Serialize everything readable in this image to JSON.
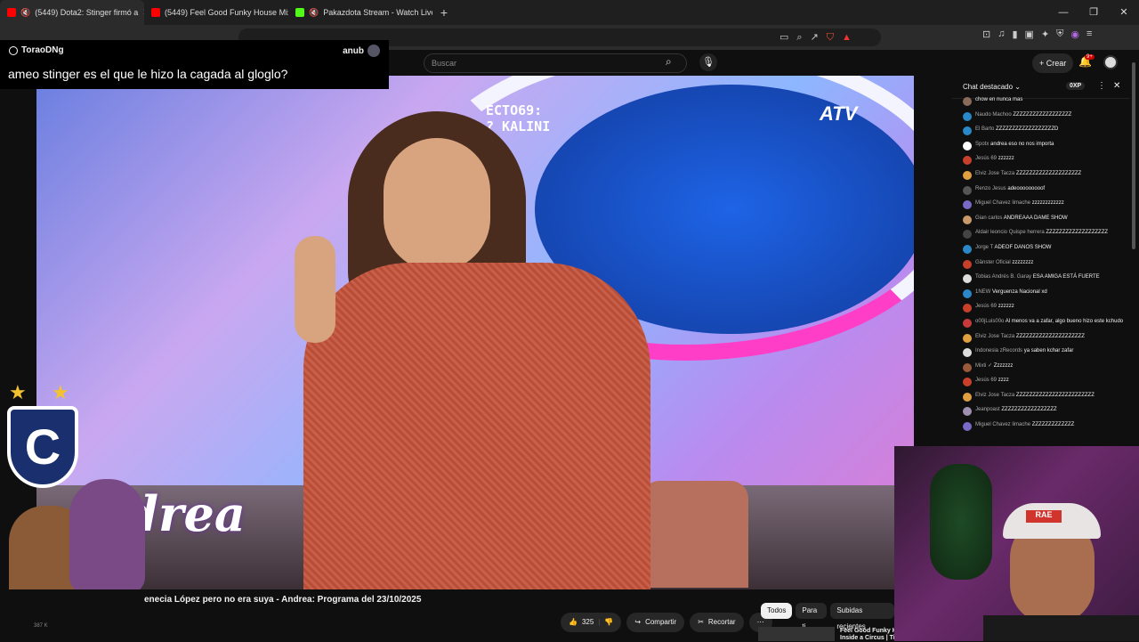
{
  "browser": {
    "tabs": [
      {
        "label": "(5449) Dota2: Stinger firmó a",
        "color": "#ff0000",
        "active": true
      },
      {
        "label": "(5449) Feel Good Funky House Mix",
        "color": "#ff0000",
        "active": false
      },
      {
        "label": "Pakazdota Stream - Watch Live o",
        "color": "#53fc18",
        "active": false
      }
    ],
    "new_tab": "+",
    "url": "",
    "window": {
      "minimize": "—",
      "restore": "❐",
      "close": "✕"
    }
  },
  "youtube": {
    "search_placeholder": "Buscar",
    "create_label": "Crear",
    "notif_count": "9+",
    "video_title": "enecia López pero no era suya - Andrea: Programa del 23/10/2025",
    "video_overlay": "ECTO69:\n? KALINI",
    "video_logo": "ndrea",
    "video_channel": "ATV",
    "likes": "325",
    "share_label": "Compartir",
    "clip_label": "Recortar",
    "chips": [
      "Todos",
      "Para ti",
      "Subidas recientes"
    ],
    "rec_title": "Feel Good Funky Ho\nInside a Circus | Tin",
    "views_snippet": "387 K"
  },
  "overlay_chat": {
    "username": "ToraoDNg",
    "right_name": "anub",
    "message": "ameo stinger es el que le hizo la cagada al gloglo?"
  },
  "chat": {
    "title": "Chat destacado",
    "points": "0XP",
    "messages": [
      {
        "name": "",
        "text": "chow en nunca mas",
        "color": "#8a6b5a"
      },
      {
        "name": "Naudo Machoo",
        "text": "ZZZZZZZZZZZZZZZZZZ",
        "color": "#2a88c8"
      },
      {
        "name": "El Barto",
        "text": "ZZZZZZZZZZZZZZZZZZD",
        "color": "#2a88c8"
      },
      {
        "name": "Spotx",
        "text": "andrea eso no nos importa",
        "color": "#ffffff"
      },
      {
        "name": "Jesús 69",
        "text": "zzzzzz",
        "color": "#c8402a"
      },
      {
        "name": "Elviz Jose Tacza",
        "text": "ZZZZZZZZZZZZZZZZZZZZ",
        "color": "#e0a040"
      },
      {
        "name": "Renzo Jesus",
        "text": "adeooooooooof",
        "color": "#555555"
      },
      {
        "name": "Miguel Chavez limache",
        "text": "zzzzzzzzzzzz",
        "color": "#7a6ac8"
      },
      {
        "name": "Gian carlos",
        "text": "ANDREAAA DAME SHOW",
        "color": "#c89a6a"
      },
      {
        "name": "Aldair leoncio Quispe herrera",
        "text": "ZZZZZZZZZZZZZZZZZZZ",
        "color": "#444444"
      },
      {
        "name": "Jorge T",
        "text": "ADEOF DANOS SHOW",
        "color": "#2a88c8"
      },
      {
        "name": "Gänster Oficial",
        "text": "zzzzzzzz",
        "color": "#c8402a"
      },
      {
        "name": "Tobias Andrés B. Garay",
        "text": "ESA AMIGA ESTÁ FUERTE",
        "color": "#dddddd"
      },
      {
        "name": "1NEW",
        "text": "Verguenza Nacional xd",
        "color": "#2a88c8"
      },
      {
        "name": "Jesús 69",
        "text": "zzzzzz",
        "color": "#c8402a"
      },
      {
        "name": "o00jLuis00o",
        "text": "Al menos va a zafar, algo bueno hizo este kchudo",
        "color": "#c83a3a"
      },
      {
        "name": "Elviz Jose Tacza",
        "text": "ZZZZZZZZZZZZZZZZZZZZZ",
        "color": "#e0a040"
      },
      {
        "name": "Indonesia zRecords",
        "text": "ya saben kchar zafar",
        "color": "#dddddd"
      },
      {
        "name": "Mixti ✓",
        "text": "Zzzzzzz",
        "color": "#9a5a3a"
      },
      {
        "name": "Jesús 69",
        "text": "zzzz",
        "color": "#c8402a"
      },
      {
        "name": "Elviz Jose Tacza",
        "text": "ZZZZZZZZZZZZZZZZZZZZZZZZ",
        "color": "#e0a040"
      },
      {
        "name": "Jeanpoast",
        "text": "ZZZZZZZZZZZZZZZZZ",
        "color": "#a090b0"
      },
      {
        "name": "Miguel Chavez limache",
        "text": "ZZZZZZZZZZZZZ",
        "color": "#7a6ac8"
      }
    ]
  },
  "stream": {
    "cap_text": "RAE"
  }
}
